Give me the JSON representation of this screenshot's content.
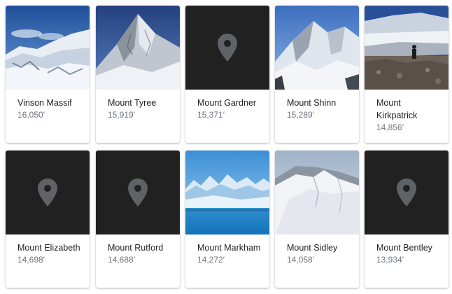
{
  "items": [
    {
      "name": "Vinson Massif",
      "elevation": "16,050′",
      "image": "mountain-photo"
    },
    {
      "name": "Mount Tyree",
      "elevation": "15,919′",
      "image": "mountain-photo"
    },
    {
      "name": "Mount Gardner",
      "elevation": "15,371′",
      "image": "location-pin-placeholder"
    },
    {
      "name": "Mount Shinn",
      "elevation": "15,289′",
      "image": "mountain-photo"
    },
    {
      "name": "Mount Kirkpatrick",
      "elevation": "14,856′",
      "image": "mountain-photo"
    },
    {
      "name": "Mount Elizabeth",
      "elevation": "14,698′",
      "image": "location-pin-placeholder"
    },
    {
      "name": "Mount Rutford",
      "elevation": "14,688′",
      "image": "location-pin-placeholder"
    },
    {
      "name": "Mount Markham",
      "elevation": "14,272′",
      "image": "mountain-photo"
    },
    {
      "name": "Mount Sidley",
      "elevation": "14,058′",
      "image": "mountain-photo"
    },
    {
      "name": "Mount Bentley",
      "elevation": "13,934′",
      "image": "location-pin-placeholder"
    }
  ]
}
